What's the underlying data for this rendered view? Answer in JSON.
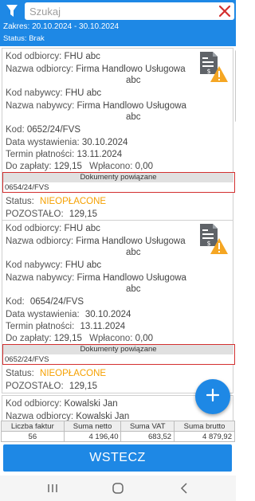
{
  "header": {
    "search_placeholder": "Szukaj",
    "range_label": "Zakres:",
    "range_value": "20.10.2024 - 30.10.2024",
    "status_label": "Status:",
    "status_value": "Brak",
    "filter_icon": "filter-icon",
    "clear_icon": "close-icon"
  },
  "labels": {
    "kod_odbiorcy": "Kod odbiorcy:",
    "nazwa_odbiorcy": "Nazwa odbiorcy:",
    "kod_nabywcy": "Kod nabywcy:",
    "nazwa_nabywcy": "Nazwa nabywcy:",
    "kod": "Kod:",
    "data_wystawienia": "Data wystawienia:",
    "termin_platnosci": "Termin płatności:",
    "do_zaplaty": "Do zapłaty:",
    "wplacono": "Wpłacono:",
    "dokumenty_powiazane": "Dokumenty powiązane",
    "status": "Status:",
    "pozostalo": "POZOSTAŁO:"
  },
  "documents": [
    {
      "kod_odbiorcy": "FHU abc",
      "nazwa_odbiorcy_1": "Firma Handlowo Usługowa",
      "nazwa_odbiorcy_2": "abc",
      "kod_nabywcy": "FHU abc",
      "nazwa_nabywcy_1": "Firma Handlowo Usługowa",
      "nazwa_nabywcy_2": "abc",
      "kod": "0652/24/FVS",
      "data_wystawienia": "30.10.2024",
      "termin_platnosci": "13.11.2024",
      "do_zaplaty": "129,15",
      "wplacono": "0,00",
      "linked": "0654/24/FVS",
      "status": "NIEOPŁACONE",
      "pozostalo": "129,15",
      "icon": "document-warning-icon"
    },
    {
      "kod_odbiorcy": "FHU abc",
      "nazwa_odbiorcy_1": "Firma Handlowo Usługowa",
      "nazwa_odbiorcy_2": "abc",
      "kod_nabywcy": "FHU abc",
      "nazwa_nabywcy_1": "Firma Handlowo Usługowa",
      "nazwa_nabywcy_2": "abc",
      "kod": "0654/24/FVS",
      "data_wystawienia": "30.10.2024",
      "termin_platnosci": "13.11.2024",
      "do_zaplaty": "129,15",
      "wplacono": "0,00",
      "linked": "0652/24/FVS",
      "status": "NIEOPŁACONE",
      "pozostalo": "129,15",
      "icon": "document-warning-icon"
    },
    {
      "kod_odbiorcy": "Kowalski Jan",
      "nazwa_odbiorcy_1": "Kowalski Jan"
    }
  ],
  "summary": {
    "headers": [
      "Liczba faktur",
      "Suma netto",
      "Suma VAT",
      "Suma brutto"
    ],
    "values": [
      "56",
      "4 196,40",
      "683,52",
      "4 879,92"
    ]
  },
  "back_button": "WSTECZ",
  "fab_icon": "plus-icon",
  "nav_icons": [
    "recent-apps-icon",
    "home-icon",
    "back-icon"
  ],
  "colors": {
    "primary": "#1e88e5",
    "status_unpaid": "#f5a000",
    "highlight_border": "#d32f2f",
    "warning": "#f5a623"
  }
}
